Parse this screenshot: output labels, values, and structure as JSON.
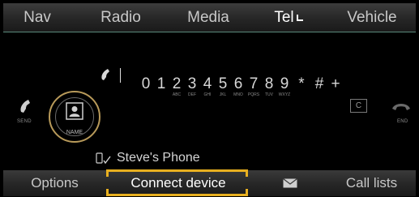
{
  "top_tabs": [
    {
      "label": "Nav"
    },
    {
      "label": "Radio"
    },
    {
      "label": "Media"
    },
    {
      "label": "Tel"
    },
    {
      "label": "Vehicle"
    }
  ],
  "dialer": {
    "send_label": "SEND",
    "end_label": "END",
    "name_label": "NAME",
    "clear_label": "C",
    "keys": [
      {
        "digit": "0",
        "letters": ""
      },
      {
        "digit": "1",
        "letters": ""
      },
      {
        "digit": "2",
        "letters": "ABC"
      },
      {
        "digit": "3",
        "letters": "DEF"
      },
      {
        "digit": "4",
        "letters": "GHI"
      },
      {
        "digit": "5",
        "letters": "JKL"
      },
      {
        "digit": "6",
        "letters": "MNO"
      },
      {
        "digit": "7",
        "letters": "PQRS"
      },
      {
        "digit": "8",
        "letters": "TUV"
      },
      {
        "digit": "9",
        "letters": "WXYZ"
      },
      {
        "digit": "*",
        "letters": ""
      },
      {
        "digit": "#",
        "letters": ""
      },
      {
        "digit": "+",
        "letters": ""
      }
    ]
  },
  "device": {
    "name": "Steve's Phone",
    "icon": "phone-connected-icon"
  },
  "bottom_bar": {
    "options_label": "Options",
    "connect_label": "Connect device",
    "messages_icon": "envelope-icon",
    "call_lists_label": "Call lists"
  },
  "colors": {
    "selection": "#e8b020",
    "ring": "#b89a5a",
    "green_rule": "#5a8a7a"
  }
}
